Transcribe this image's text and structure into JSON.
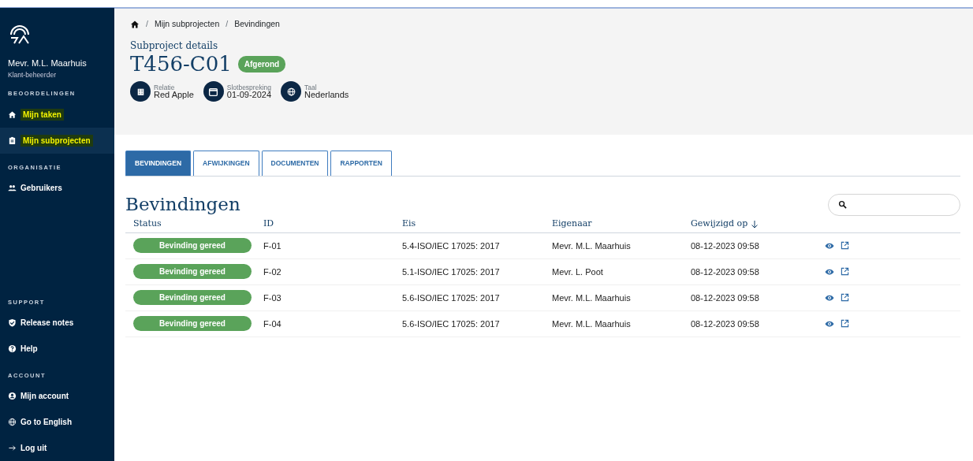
{
  "sidebar": {
    "user_name": "Mevr. M.L. Maarhuis",
    "user_role": "Klant-beheerder",
    "sections": [
      {
        "title": "BEOORDELINGEN",
        "items": [
          {
            "label": "Mijn taken",
            "selected": false,
            "highlighted": true
          },
          {
            "label": "Mijn subprojecten",
            "selected": true,
            "highlighted": true
          }
        ]
      },
      {
        "title": "ORGANISATIE",
        "items": [
          {
            "label": "Gebruikers",
            "selected": false,
            "highlighted": false
          }
        ]
      },
      {
        "title": "SUPPORT",
        "items": [
          {
            "label": "Release notes",
            "selected": false,
            "highlighted": false
          },
          {
            "label": "Help",
            "selected": false,
            "highlighted": false
          }
        ]
      },
      {
        "title": "ACCOUNT",
        "items": [
          {
            "label": "Mijn account",
            "selected": false,
            "highlighted": false
          },
          {
            "label": "Go to English",
            "selected": false,
            "highlighted": false
          },
          {
            "label": "Log uit",
            "selected": false,
            "highlighted": false
          }
        ]
      }
    ]
  },
  "breadcrumb": [
    {
      "separator": "/",
      "label": "Mijn subprojecten"
    },
    {
      "separator": "/",
      "label": "Bevindingen"
    }
  ],
  "header": {
    "subtitle": "Subproject details",
    "title": "T456-C01",
    "status": "Afgerond",
    "facts": [
      {
        "label": "Relatie",
        "value": "Red Apple"
      },
      {
        "label": "Slotbespreking",
        "value": "01-09-2024"
      },
      {
        "label": "Taal",
        "value": "Nederlands"
      }
    ]
  },
  "tabs": [
    {
      "label": "BEVINDINGEN",
      "selected": true
    },
    {
      "label": "AFWIJKINGEN",
      "selected": false
    },
    {
      "label": "DOCUMENTEN",
      "selected": false
    },
    {
      "label": "RAPPORTEN",
      "selected": false
    }
  ],
  "section_title": "Bevindingen",
  "table": {
    "columns": [
      {
        "label": "Status",
        "sorted": false
      },
      {
        "label": "ID",
        "sorted": false
      },
      {
        "label": "Eis",
        "sorted": false
      },
      {
        "label": "Eigenaar",
        "sorted": false
      },
      {
        "label": "Gewijzigd op",
        "sorted": true
      }
    ],
    "rows": [
      {
        "status": "Bevinding gereed",
        "color": "#5aa35a",
        "id": "F-01",
        "eis": "5.4-ISO/IEC 17025: 2017",
        "eigenaar": "Mevr. M.L. Maarhuis",
        "gewijzigd": "08-12-2023 09:58"
      },
      {
        "status": "Bevinding gereed",
        "color": "#5aa35a",
        "id": "F-02",
        "eis": "5.1-ISO/IEC 17025: 2017",
        "eigenaar": "Mevr. L. Poot",
        "gewijzigd": "08-12-2023 09:58"
      },
      {
        "status": "Bevinding gereed",
        "color": "#5aa35a",
        "id": "F-03",
        "eis": "5.6-ISO/IEC 17025: 2017",
        "eigenaar": "Mevr. M.L. Maarhuis",
        "gewijzigd": "08-12-2023 09:58"
      },
      {
        "status": "Bevinding gereed",
        "color": "#5aa35a",
        "id": "F-04",
        "eis": "5.6-ISO/IEC 17025: 2017",
        "eigenaar": "Mevr. M.L. Maarhuis",
        "gewijzigd": "08-12-2023 09:58"
      }
    ]
  }
}
